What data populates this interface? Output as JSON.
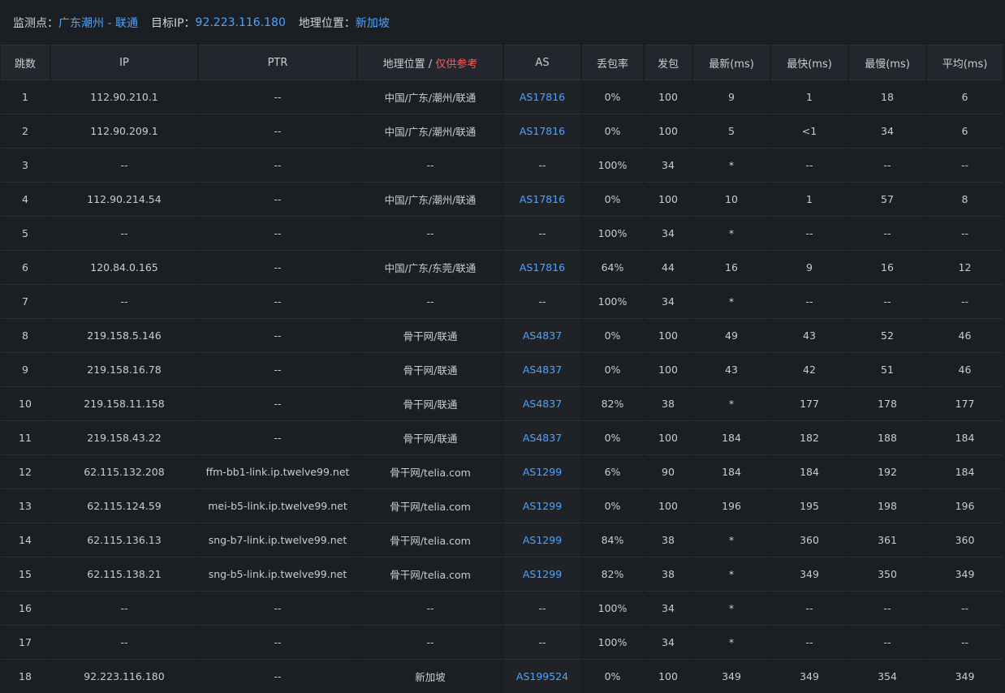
{
  "info": {
    "monitor_label": "监测点：",
    "monitor_value": "广东潮州 - 联通",
    "target_label": "目标IP：",
    "target_value": "92.223.116.180",
    "geo_label": "地理位置：",
    "geo_value": "新加坡"
  },
  "colors": {
    "background": "#1b1e23",
    "header_bg": "#23272d",
    "link": "#4da3ff",
    "warning": "#ff5b5b"
  },
  "headers": {
    "hop": "跳数",
    "ip": "IP",
    "ptr": "PTR",
    "geo": "地理位置",
    "geo_sep": " / ",
    "geo_ref": "仅供参考",
    "as": "AS",
    "loss": "丢包率",
    "sent": "发包",
    "last": "最新(ms)",
    "best": "最快(ms)",
    "worst": "最慢(ms)",
    "avg": "平均(ms)"
  },
  "rows": [
    {
      "hop": "1",
      "ip": "112.90.210.1",
      "ptr": "--",
      "geo": "中国/广东/潮州/联通",
      "as": "AS17816",
      "loss": "0%",
      "sent": "100",
      "last": "9",
      "best": "1",
      "worst": "18",
      "avg": "6"
    },
    {
      "hop": "2",
      "ip": "112.90.209.1",
      "ptr": "--",
      "geo": "中国/广东/潮州/联通",
      "as": "AS17816",
      "loss": "0%",
      "sent": "100",
      "last": "5",
      "best": "<1",
      "worst": "34",
      "avg": "6"
    },
    {
      "hop": "3",
      "ip": "--",
      "ptr": "--",
      "geo": "--",
      "as": "--",
      "loss": "100%",
      "sent": "34",
      "last": "*",
      "best": "--",
      "worst": "--",
      "avg": "--"
    },
    {
      "hop": "4",
      "ip": "112.90.214.54",
      "ptr": "--",
      "geo": "中国/广东/潮州/联通",
      "as": "AS17816",
      "loss": "0%",
      "sent": "100",
      "last": "10",
      "best": "1",
      "worst": "57",
      "avg": "8"
    },
    {
      "hop": "5",
      "ip": "--",
      "ptr": "--",
      "geo": "--",
      "as": "--",
      "loss": "100%",
      "sent": "34",
      "last": "*",
      "best": "--",
      "worst": "--",
      "avg": "--"
    },
    {
      "hop": "6",
      "ip": "120.84.0.165",
      "ptr": "--",
      "geo": "中国/广东/东莞/联通",
      "as": "AS17816",
      "loss": "64%",
      "sent": "44",
      "last": "16",
      "best": "9",
      "worst": "16",
      "avg": "12"
    },
    {
      "hop": "7",
      "ip": "--",
      "ptr": "--",
      "geo": "--",
      "as": "--",
      "loss": "100%",
      "sent": "34",
      "last": "*",
      "best": "--",
      "worst": "--",
      "avg": "--"
    },
    {
      "hop": "8",
      "ip": "219.158.5.146",
      "ptr": "--",
      "geo": "骨干网/联通",
      "as": "AS4837",
      "loss": "0%",
      "sent": "100",
      "last": "49",
      "best": "43",
      "worst": "52",
      "avg": "46"
    },
    {
      "hop": "9",
      "ip": "219.158.16.78",
      "ptr": "--",
      "geo": "骨干网/联通",
      "as": "AS4837",
      "loss": "0%",
      "sent": "100",
      "last": "43",
      "best": "42",
      "worst": "51",
      "avg": "46"
    },
    {
      "hop": "10",
      "ip": "219.158.11.158",
      "ptr": "--",
      "geo": "骨干网/联通",
      "as": "AS4837",
      "loss": "82%",
      "sent": "38",
      "last": "*",
      "best": "177",
      "worst": "178",
      "avg": "177"
    },
    {
      "hop": "11",
      "ip": "219.158.43.22",
      "ptr": "--",
      "geo": "骨干网/联通",
      "as": "AS4837",
      "loss": "0%",
      "sent": "100",
      "last": "184",
      "best": "182",
      "worst": "188",
      "avg": "184"
    },
    {
      "hop": "12",
      "ip": "62.115.132.208",
      "ptr": "ffm-bb1-link.ip.twelve99.net",
      "geo": "骨干网/telia.com",
      "as": "AS1299",
      "loss": "6%",
      "sent": "90",
      "last": "184",
      "best": "184",
      "worst": "192",
      "avg": "184"
    },
    {
      "hop": "13",
      "ip": "62.115.124.59",
      "ptr": "mei-b5-link.ip.twelve99.net",
      "geo": "骨干网/telia.com",
      "as": "AS1299",
      "loss": "0%",
      "sent": "100",
      "last": "196",
      "best": "195",
      "worst": "198",
      "avg": "196"
    },
    {
      "hop": "14",
      "ip": "62.115.136.13",
      "ptr": "sng-b7-link.ip.twelve99.net",
      "geo": "骨干网/telia.com",
      "as": "AS1299",
      "loss": "84%",
      "sent": "38",
      "last": "*",
      "best": "360",
      "worst": "361",
      "avg": "360"
    },
    {
      "hop": "15",
      "ip": "62.115.138.21",
      "ptr": "sng-b5-link.ip.twelve99.net",
      "geo": "骨干网/telia.com",
      "as": "AS1299",
      "loss": "82%",
      "sent": "38",
      "last": "*",
      "best": "349",
      "worst": "350",
      "avg": "349"
    },
    {
      "hop": "16",
      "ip": "--",
      "ptr": "--",
      "geo": "--",
      "as": "--",
      "loss": "100%",
      "sent": "34",
      "last": "*",
      "best": "--",
      "worst": "--",
      "avg": "--"
    },
    {
      "hop": "17",
      "ip": "--",
      "ptr": "--",
      "geo": "--",
      "as": "--",
      "loss": "100%",
      "sent": "34",
      "last": "*",
      "best": "--",
      "worst": "--",
      "avg": "--"
    },
    {
      "hop": "18",
      "ip": "92.223.116.180",
      "ptr": "--",
      "geo": "新加坡",
      "as": "AS199524",
      "loss": "0%",
      "sent": "100",
      "last": "349",
      "best": "349",
      "worst": "354",
      "avg": "349"
    }
  ]
}
